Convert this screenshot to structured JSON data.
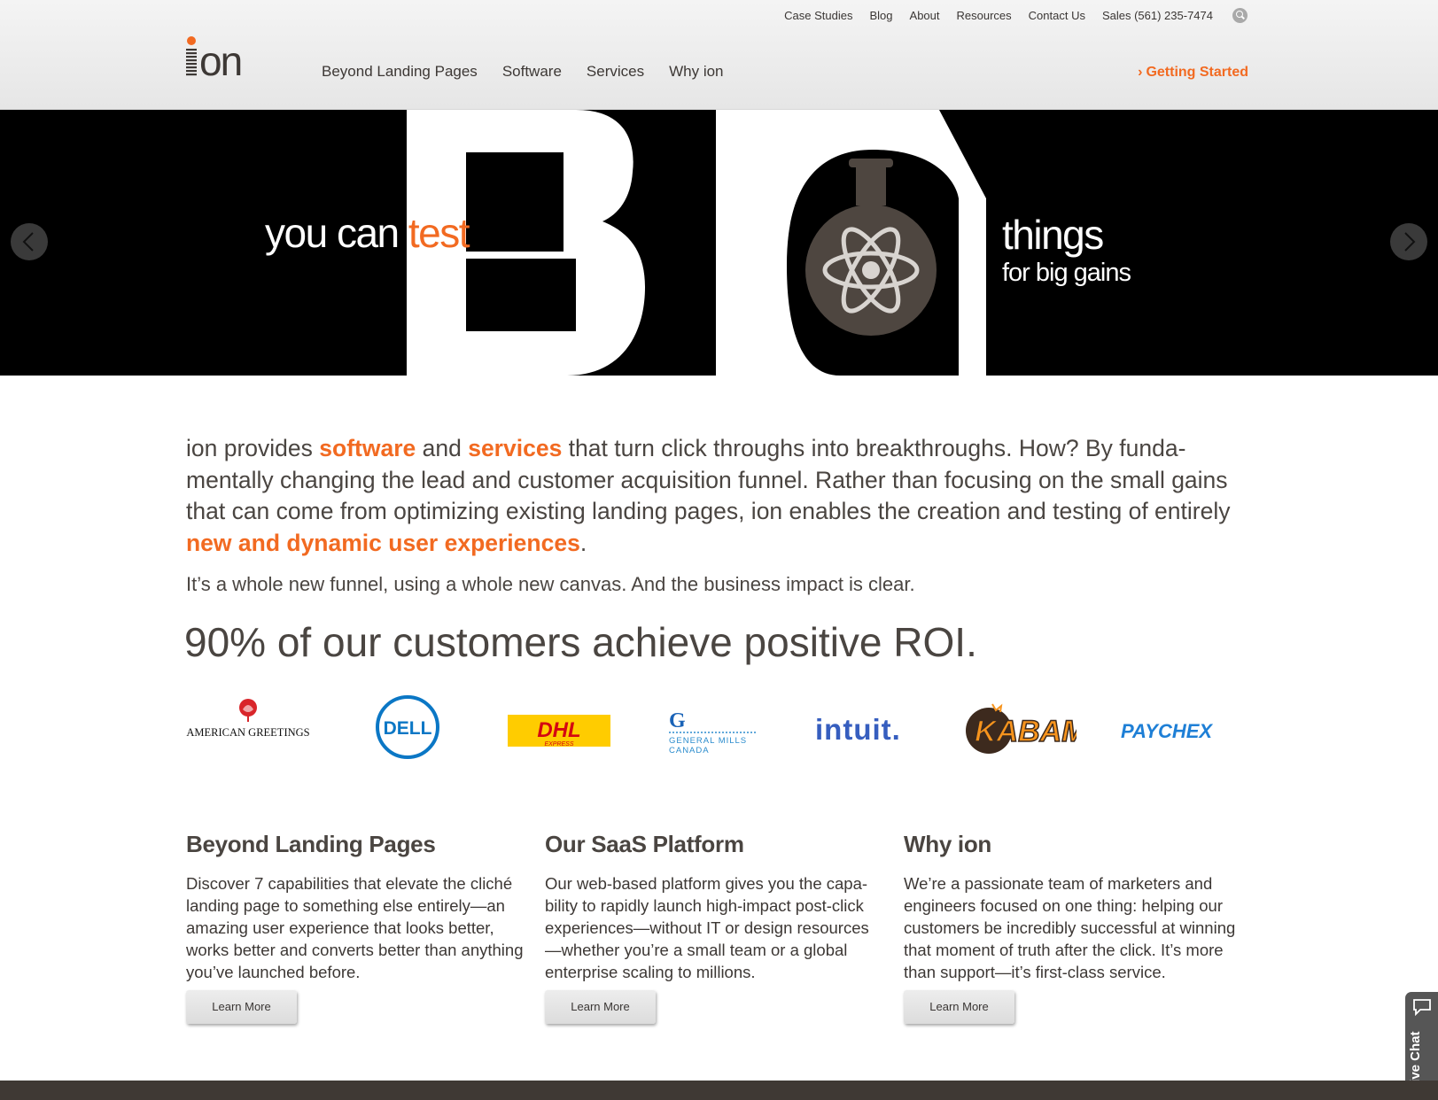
{
  "utility_nav": [
    {
      "label": "Case Studies"
    },
    {
      "label": "Blog"
    },
    {
      "label": "About"
    },
    {
      "label": "Resources"
    },
    {
      "label": "Contact Us"
    },
    {
      "label": "Sales (561) 235-7474"
    }
  ],
  "logo": {
    "text": "ion"
  },
  "main_nav": [
    {
      "label": "Beyond Landing Pages"
    },
    {
      "label": "Software"
    },
    {
      "label": "Services"
    },
    {
      "label": "Why ion"
    }
  ],
  "cta": {
    "label": "Getting Started",
    "icon": "chevron-right-icon",
    "color": "#f26a21"
  },
  "hero": {
    "text_left": "you can ",
    "text_left_accent": "test",
    "big_word": "BIG",
    "text_right": "things",
    "text_right_sub": "for big gains",
    "icon": "flask-atom-icon",
    "prev_icon": "chevron-left-icon",
    "next_icon": "chevron-right-icon"
  },
  "intro": {
    "p1_a": "ion provides ",
    "p1_software": "software",
    "p1_b": " and ",
    "p1_services": "services",
    "p1_c": " that turn click throughs into breakthroughs. How? By funda­mentally changing the lead and customer acquisition funnel. Rather than focusing on the small gains that can come from optimizing existing landing pages, ion enables the creation and testing of entirely ",
    "p1_highlight": "new and dynamic user experiences",
    "p1_end": ".",
    "tagline": "It’s a whole new funnel, using a whole new canvas. And the business impact is clear.",
    "roi": "90% of our customers achieve positive ROI."
  },
  "customer_logos": [
    {
      "name": "American Greetings",
      "text": "AMERICAN GREETINGS"
    },
    {
      "name": "Dell",
      "text": "DELL"
    },
    {
      "name": "DHL",
      "text": "DHL",
      "sub": "EXPRESS"
    },
    {
      "name": "General Mills Canada",
      "line1": "GENERAL MILLS",
      "line2": "CANADA"
    },
    {
      "name": "Intuit",
      "text": "intuit."
    },
    {
      "name": "Kabam",
      "text": "KABAM"
    },
    {
      "name": "Paychex",
      "text": "PAYCHEX"
    }
  ],
  "columns": [
    {
      "title": "Beyond Landing Pages",
      "body": "Discover 7 capabilities that elevate the cliché landing page to something else entirely—an amazing user experience that looks better, works better and converts better than any­thing you’ve launched before.",
      "button": "Learn More"
    },
    {
      "title": "Our SaaS Platform",
      "body": "Our web-based platform gives you the capa­bility to rapidly launch high-impact post-click experiences—without IT or design resources —whether you’re a small team or a global enterprise scaling to millions.",
      "button": "Learn More"
    },
    {
      "title": "Why ion",
      "body": "We’re a passionate team of marketers and engineers focused on one thing: helping our customers be incredibly successful at winning that moment of truth after the click. It’s more than support—it’s first-class service.",
      "button": "Learn More"
    }
  ],
  "live_chat": {
    "label": "Live Chat",
    "icon": "chat-bubble-icon"
  },
  "colors": {
    "accent": "#f26a21",
    "text": "#4a4541",
    "hero_bg": "#000000",
    "footer": "#3f3934"
  }
}
